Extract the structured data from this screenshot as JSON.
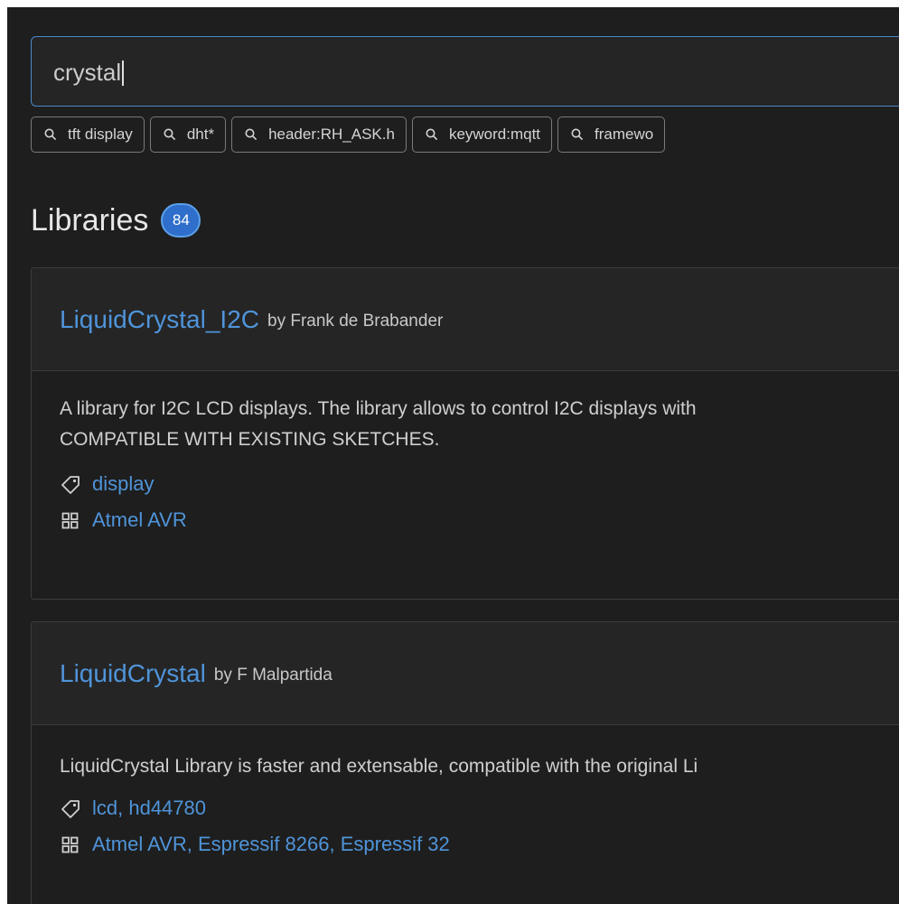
{
  "search": {
    "value": "crystal"
  },
  "suggestions": [
    {
      "label": "tft display"
    },
    {
      "label": "dht*"
    },
    {
      "label": "header:RH_ASK.h"
    },
    {
      "label": "keyword:mqtt"
    },
    {
      "label": "framewo"
    }
  ],
  "libraries": {
    "title": "Libraries",
    "count": "84",
    "items": [
      {
        "name": "LiquidCrystal_I2C",
        "author": "by Frank de Brabander",
        "description_lines": [
          "A library for I2C LCD displays. The library allows to control I2C displays with",
          "COMPATIBLE WITH EXISTING SKETCHES."
        ],
        "keywords": "display",
        "platforms": "Atmel AVR"
      },
      {
        "name": "LiquidCrystal",
        "author": "by F Malpartida",
        "description_lines": [
          "LiquidCrystal Library is faster and extensable, compatible with the original Li"
        ],
        "keywords": "lcd, hd44780",
        "platforms": "Atmel AVR, Espressif 8266, Espressif 32"
      }
    ]
  },
  "colors": {
    "background": "#1e1e1e",
    "accent": "#2f6fcb",
    "link": "#4f94d9",
    "focus_border": "#4a89c8"
  },
  "icons": {
    "chip": "search-icon",
    "keywords": "tag-icon",
    "platforms": "grid-icon"
  }
}
